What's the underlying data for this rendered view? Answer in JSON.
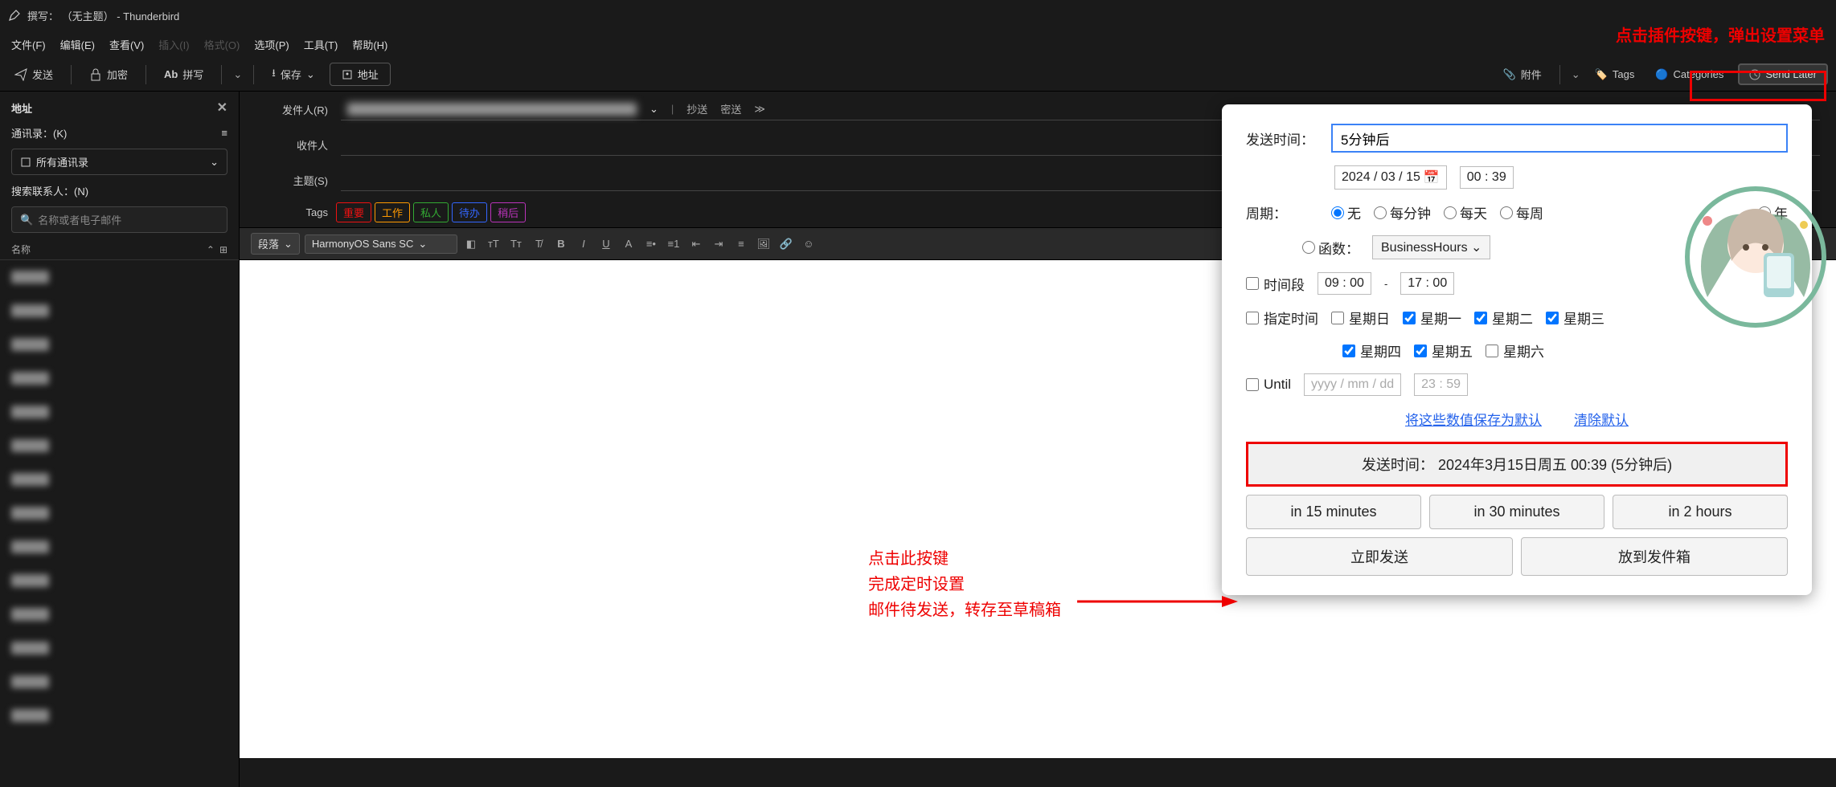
{
  "window": {
    "title": "撰写：  （无主题）  - Thunderbird"
  },
  "menu": {
    "file": "文件(F)",
    "edit": "编辑(E)",
    "view": "查看(V)",
    "insert": "插入(I)",
    "format": "格式(O)",
    "options": "选项(P)",
    "tools": "工具(T)",
    "help": "帮助(H)"
  },
  "toolbar": {
    "send": "发送",
    "encrypt": "加密",
    "spelling": "拼写",
    "save": "保存",
    "address": "地址",
    "attach": "附件",
    "tags": "Tags",
    "categories": "Categories",
    "send_later": "Send Later"
  },
  "sidebar": {
    "header": "地址",
    "book_label": "通讯录：(K)",
    "book_select": "所有通讯录",
    "search_label": "搜索联系人：(N)",
    "search_placeholder": "名称或者电子邮件",
    "col_name": "名称",
    "contacts": [
      "████",
      "████",
      "████",
      "████",
      "████",
      "████",
      "████",
      "████",
      "████",
      "████",
      "████",
      "████",
      "████",
      "████"
    ]
  },
  "compose": {
    "from_label": "发件人(R)",
    "to_label": "收件人",
    "subject_label": "主题(S)",
    "cc": "抄送",
    "bcc": "密送",
    "tags_label": "Tags",
    "tags": [
      {
        "t": "重要",
        "c": "#e11"
      },
      {
        "t": "工作",
        "c": "#f90"
      },
      {
        "t": "私人",
        "c": "#3a3"
      },
      {
        "t": "待办",
        "c": "#36f"
      },
      {
        "t": "稍后",
        "c": "#b3b"
      }
    ],
    "para": "段落",
    "font": "HarmonyOS Sans SC"
  },
  "popup": {
    "send_time_label": "发送时间：",
    "send_time_value": "5分钟后",
    "date": "2024 / 03 / 15",
    "time": "00 : 39",
    "period_label": "周期：",
    "period_none": "无",
    "period_min": "每分钟",
    "period_day": "每天",
    "period_week": "每周",
    "period_year": "年",
    "func_label": "函数：",
    "func_value": "BusinessHours",
    "range_label": "时间段",
    "range_from": "09 : 00",
    "range_to": "17 : 00",
    "days_label": "指定时间",
    "d0": "星期日",
    "d1": "星期一",
    "d2": "星期二",
    "d3": "星期三",
    "d4": "星期四",
    "d5": "星期五",
    "d6": "星期六",
    "until_label": "Until",
    "until_date": "yyyy / mm / dd",
    "until_time": "23 : 59",
    "save_defaults": "将这些数值保存为默认",
    "clear_defaults": "清除默认",
    "main_button": "发送时间：  2024年3月15日周五 00:39 (5分钟后)",
    "b15": "in 15 minutes",
    "b30": "in 30 minutes",
    "b2h": "in 2 hours",
    "send_now": "立即发送",
    "to_outbox": "放到发件箱"
  },
  "anno": {
    "top": "点击插件按键，弹出设置菜单",
    "m1": "点击此按键",
    "m2": "完成定时设置",
    "m3": "邮件待发送，转存至草稿箱"
  }
}
